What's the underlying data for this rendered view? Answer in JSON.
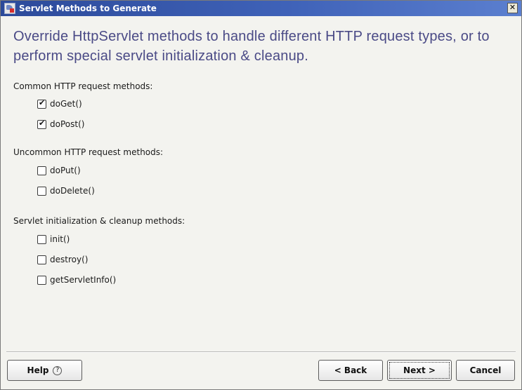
{
  "window": {
    "title": "Servlet Methods to Generate",
    "close_glyph": "✕"
  },
  "heading": "Override HttpServlet methods to handle different HTTP request types, or to perform special servlet initialization & cleanup.",
  "groups": [
    {
      "label": "Common HTTP request methods:",
      "items": [
        {
          "label": "doGet()",
          "checked": true
        },
        {
          "label": "doPost()",
          "checked": true
        }
      ]
    },
    {
      "label": "Uncommon HTTP request methods:",
      "items": [
        {
          "label": "doPut()",
          "checked": false
        },
        {
          "label": "doDelete()",
          "checked": false
        }
      ]
    },
    {
      "label": "Servlet initialization & cleanup methods:",
      "items": [
        {
          "label": "init()",
          "checked": false
        },
        {
          "label": "destroy()",
          "checked": false
        },
        {
          "label": "getServletInfo()",
          "checked": false
        }
      ]
    }
  ],
  "buttons": {
    "help": "Help",
    "help_icon": "?",
    "back": "< Back",
    "next": "Next >",
    "cancel": "Cancel"
  }
}
